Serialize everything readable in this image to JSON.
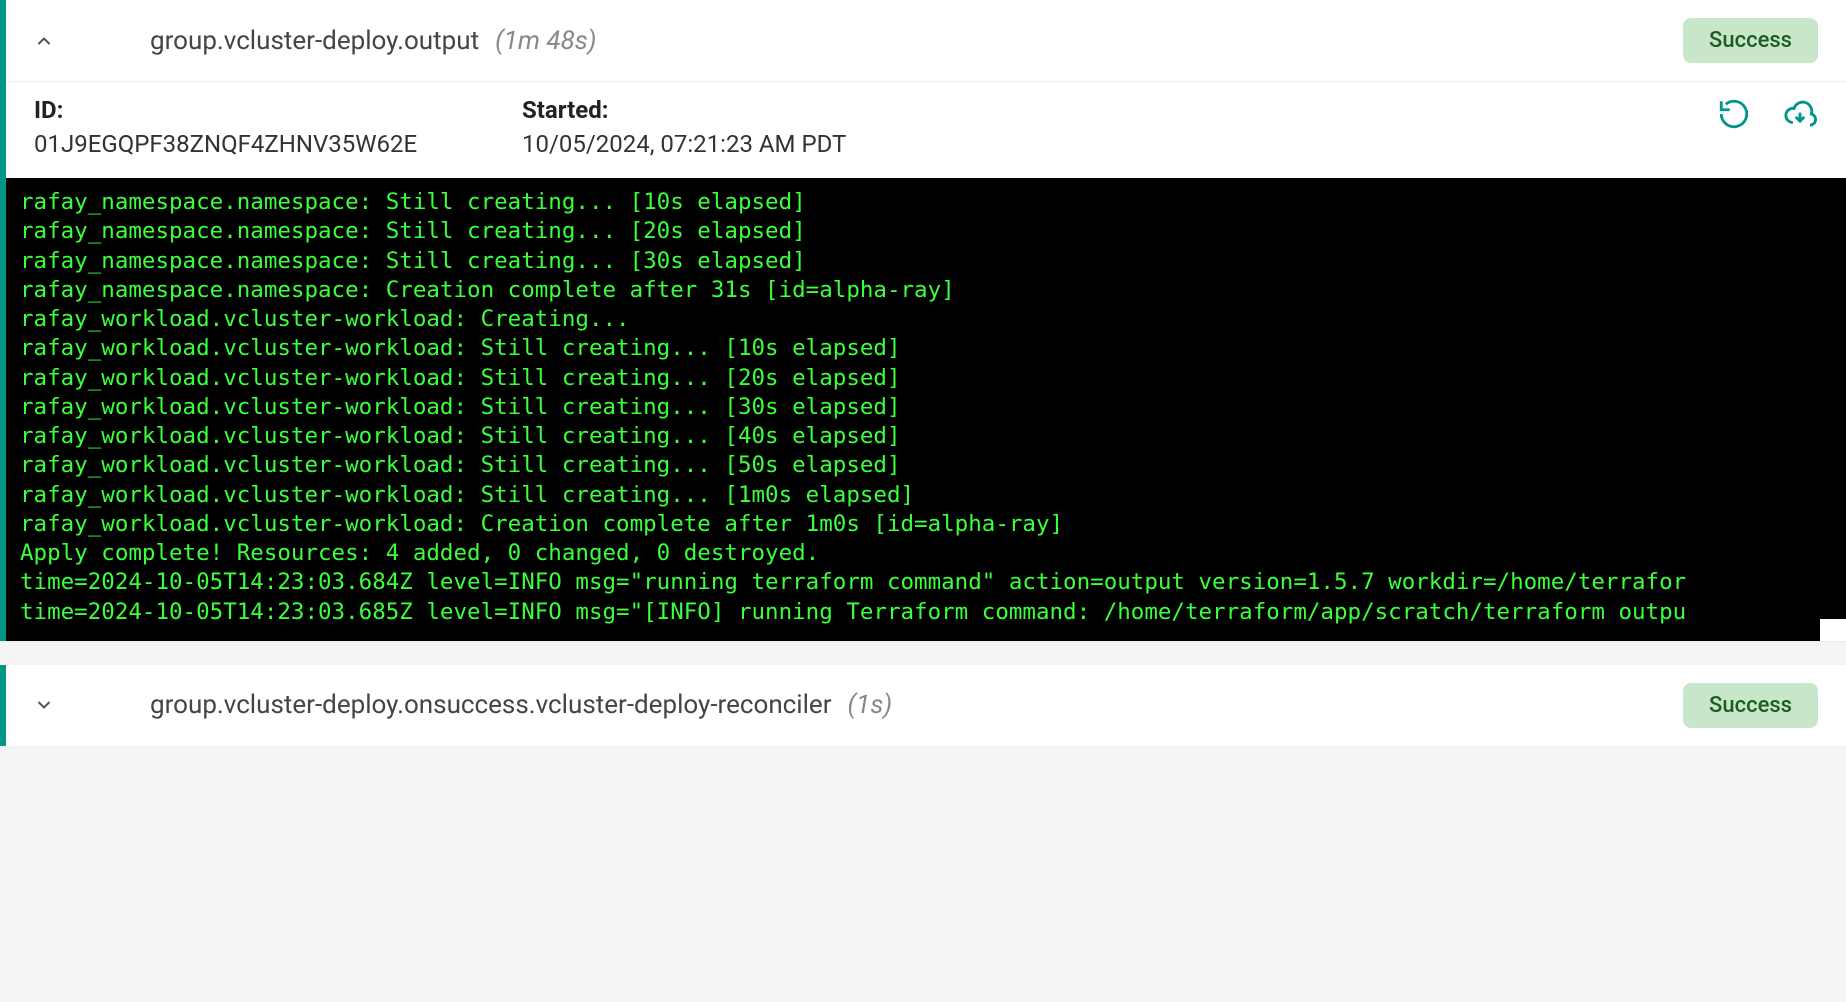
{
  "steps": [
    {
      "title": "group.vcluster-deploy.output",
      "duration": "(1m 48s)",
      "status": "Success",
      "expanded": true,
      "meta": {
        "id_label": "ID:",
        "id_value": "01J9EGQPF38ZNQF4ZHNV35W62E",
        "started_label": "Started:",
        "started_value": "10/05/2024, 07:21:23 AM PDT"
      },
      "log_lines": [
        "rafay_namespace.namespace: Still creating... [10s elapsed]",
        "rafay_namespace.namespace: Still creating... [20s elapsed]",
        "rafay_namespace.namespace: Still creating... [30s elapsed]",
        "rafay_namespace.namespace: Creation complete after 31s [id=alpha-ray]",
        "rafay_workload.vcluster-workload: Creating...",
        "rafay_workload.vcluster-workload: Still creating... [10s elapsed]",
        "rafay_workload.vcluster-workload: Still creating... [20s elapsed]",
        "rafay_workload.vcluster-workload: Still creating... [30s elapsed]",
        "rafay_workload.vcluster-workload: Still creating... [40s elapsed]",
        "rafay_workload.vcluster-workload: Still creating... [50s elapsed]",
        "rafay_workload.vcluster-workload: Still creating... [1m0s elapsed]",
        "rafay_workload.vcluster-workload: Creation complete after 1m0s [id=alpha-ray]",
        "",
        "Apply complete! Resources: 4 added, 0 changed, 0 destroyed.",
        "time=2024-10-05T14:23:03.684Z level=INFO msg=\"running terraform command\" action=output version=1.5.7 workdir=/home/terrafor",
        "time=2024-10-05T14:23:03.685Z level=INFO msg=\"[INFO] running Terraform command: /home/terraform/app/scratch/terraform outpu"
      ]
    },
    {
      "title": "group.vcluster-deploy.onsuccess.vcluster-deploy-reconciler",
      "duration": "(1s)",
      "status": "Success",
      "expanded": false
    }
  ],
  "colors": {
    "accent": "#009688",
    "success_bg": "#c8e6c9",
    "success_fg": "#1b5e20",
    "terminal_fg": "#3cff3c"
  }
}
